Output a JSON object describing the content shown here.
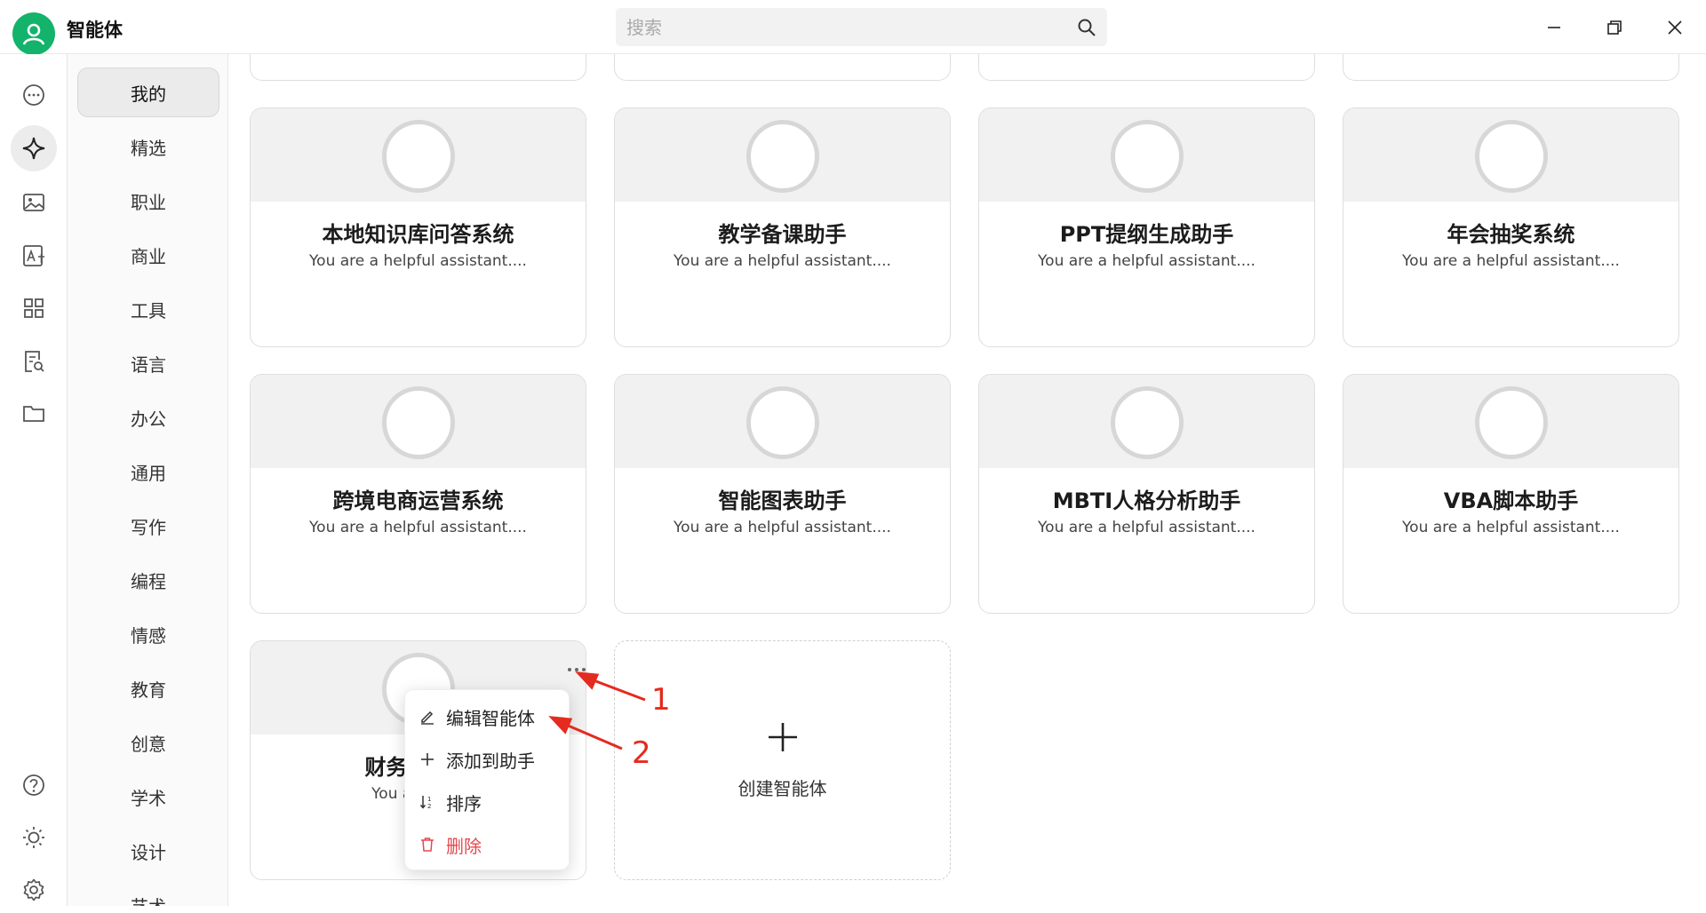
{
  "app": {
    "title": "智能体"
  },
  "search": {
    "placeholder": "搜索",
    "value": ""
  },
  "window_controls": {
    "icons": [
      "minimize-icon",
      "restore-icon",
      "close-icon"
    ]
  },
  "rail": {
    "items": [
      {
        "icon": "chat-bubble-icon",
        "active": false
      },
      {
        "icon": "sparkle-icon",
        "active": true
      },
      {
        "icon": "image-icon",
        "active": false
      },
      {
        "icon": "translate-icon",
        "active": false
      },
      {
        "icon": "apps-grid-icon",
        "active": false
      },
      {
        "icon": "doc-search-icon",
        "active": false
      },
      {
        "icon": "folder-icon",
        "active": false
      }
    ],
    "bottom": [
      "help-icon",
      "theme-sun-icon",
      "settings-gear-icon"
    ]
  },
  "categories": {
    "active": "我的",
    "items": [
      "我的",
      "精选",
      "职业",
      "商业",
      "工具",
      "语言",
      "办公",
      "通用",
      "写作",
      "编程",
      "情感",
      "教育",
      "创意",
      "学术",
      "设计",
      "艺术"
    ]
  },
  "agents": [
    {
      "name": "本地知识库问答系统",
      "desc": "You are a helpful assistant...."
    },
    {
      "name": "教学备课助手",
      "desc": "You are a helpful assistant...."
    },
    {
      "name": "PPT提纲生成助手",
      "desc": "You are a helpful assistant...."
    },
    {
      "name": "年会抽奖系统",
      "desc": "You are a helpful assistant...."
    },
    {
      "name": "跨境电商运营系统",
      "desc": "You are a helpful assistant...."
    },
    {
      "name": "智能图表助手",
      "desc": "You are a helpful assistant...."
    },
    {
      "name": "MBTI人格分析助手",
      "desc": "You are a helpful assistant...."
    },
    {
      "name": "VBA脚本助手",
      "desc": "You are a helpful assistant...."
    },
    {
      "name": "财务报表智",
      "desc": "You are a he"
    }
  ],
  "create_card": {
    "label": "创建智能体"
  },
  "context_menu": {
    "items": [
      {
        "label": "编辑智能体",
        "icon": "pencil-icon"
      },
      {
        "label": "添加到助手",
        "icon": "plus-icon"
      },
      {
        "label": "排序",
        "icon": "sort-icon"
      },
      {
        "label": "删除",
        "icon": "trash-icon",
        "color": "#e5484d"
      }
    ]
  },
  "annotations": {
    "labels": [
      "1",
      "2"
    ],
    "color": "#e52a1f"
  },
  "colors": {
    "brand": "#13b36b",
    "danger": "#e5484d"
  }
}
